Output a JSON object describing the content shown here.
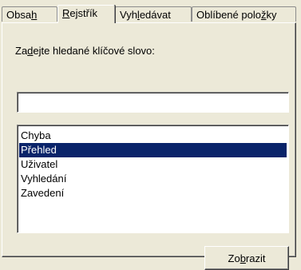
{
  "tabs": [
    {
      "pre": "Obsa",
      "key": "h",
      "post": "",
      "active": false
    },
    {
      "pre": "",
      "key": "R",
      "post": "ejstřík",
      "active": true
    },
    {
      "pre": "Vyh",
      "key": "l",
      "post": "edávat",
      "active": false
    },
    {
      "pre": "Oblíbené polo",
      "key": "ž",
      "post": "ky",
      "active": false
    }
  ],
  "index": {
    "prompt": {
      "pre": "Za",
      "key": "d",
      "post": "ejte hledané klíčové slovo:"
    },
    "search_value": "",
    "items": [
      "Chyba",
      "Přehled",
      "Uživatel",
      "Vyhledání",
      "Zavedení"
    ],
    "selected_index": 1,
    "display_button": {
      "pre": "Zo",
      "key": "b",
      "post": "razit"
    }
  },
  "colors": {
    "face": "#ece9d8",
    "selection": "#0a246a"
  }
}
